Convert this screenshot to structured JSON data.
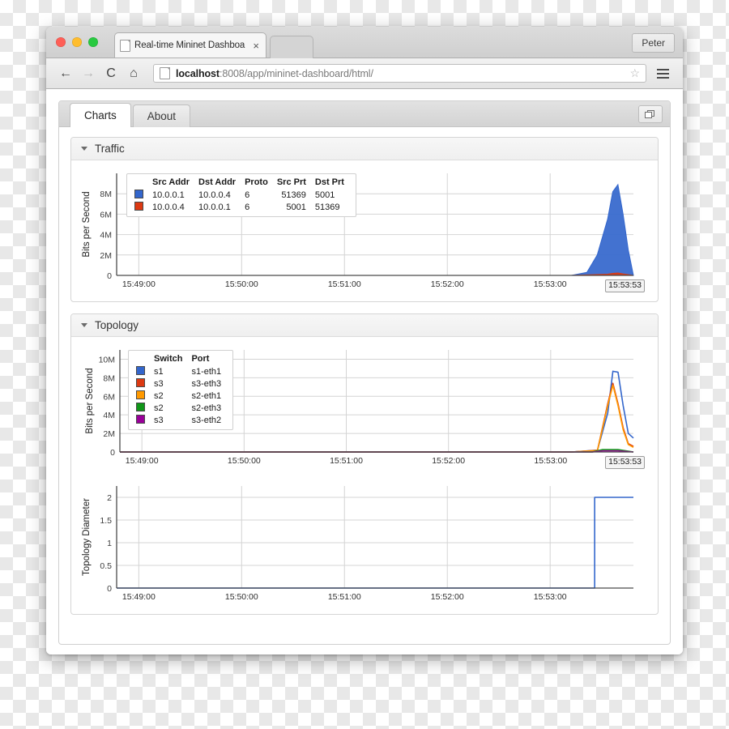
{
  "browser": {
    "tab_title": "Real-time Mininet Dashboa",
    "tab_close_glyph": "×",
    "user_label": "Peter",
    "back_glyph": "←",
    "forward_glyph": "→",
    "reload_glyph": "C",
    "home_glyph": "⌂",
    "star_glyph": "☆",
    "url_prefix": "localhost",
    "url_suffix": ":8008/app/mininet-dashboard/html/"
  },
  "app": {
    "tabs": [
      {
        "label": "Charts",
        "active": true
      },
      {
        "label": "About",
        "active": false
      }
    ],
    "windows_button_name": "open-in-new-window"
  },
  "panels": [
    {
      "title": "Traffic"
    },
    {
      "title": "Topology"
    }
  ],
  "colors": {
    "series_blue": "#3366cc",
    "series_red": "#dc3912",
    "series_orange": "#ff9900",
    "series_green": "#109618",
    "series_purple": "#990099",
    "axis": "#4a4a4a",
    "grid": "#d4d4d4"
  },
  "chart_data": [
    {
      "id": "traffic-chart",
      "type": "area",
      "title": "Traffic",
      "xlabel": "",
      "ylabel": "Bits per Second",
      "ylim": [
        0,
        10000000
      ],
      "yticks": [
        "0",
        "2M",
        "4M",
        "6M",
        "8M"
      ],
      "ytick_values": [
        0,
        2000000,
        4000000,
        6000000,
        8000000
      ],
      "xticks": [
        "15:49:00",
        "15:50:00",
        "15:51:00",
        "15:52:00",
        "15:53:00"
      ],
      "xlim": [
        "15:48:53",
        "15:53:53"
      ],
      "current_time_badge": "15:53:53",
      "grid": true,
      "legend_position": "inside-top-left",
      "legend_columns": [
        "Src Addr",
        "Dst Addr",
        "Proto",
        "Src Prt",
        "Dst Prt"
      ],
      "series": [
        {
          "name": "10.0.0.1 → 10.0.0.4",
          "color": "#3366cc",
          "legend": {
            "src_addr": "10.0.0.1",
            "dst_addr": "10.0.0.4",
            "proto": "6",
            "src_prt": "51369",
            "dst_prt": "5001"
          },
          "x": [
            0,
            88,
            91,
            93,
            95,
            96,
            97,
            98,
            99,
            100
          ],
          "values": [
            0,
            0,
            300000,
            2000000,
            5500000,
            8200000,
            8900000,
            6000000,
            2500000,
            0
          ]
        },
        {
          "name": "10.0.0.4 → 10.0.0.1",
          "color": "#dc3912",
          "legend": {
            "src_addr": "10.0.0.4",
            "dst_addr": "10.0.0.1",
            "proto": "6",
            "src_prt": "5001",
            "dst_prt": "51369"
          },
          "x": [
            0,
            88,
            95,
            96,
            97,
            98,
            100
          ],
          "values": [
            0,
            0,
            120000,
            200000,
            240000,
            150000,
            0
          ]
        }
      ]
    },
    {
      "id": "topology-traffic-chart",
      "type": "line",
      "title": "Topology",
      "xlabel": "",
      "ylabel": "Bits per Second",
      "ylim": [
        0,
        11000000
      ],
      "yticks": [
        "0",
        "2M",
        "4M",
        "6M",
        "8M",
        "10M"
      ],
      "ytick_values": [
        0,
        2000000,
        4000000,
        6000000,
        8000000,
        10000000
      ],
      "xticks": [
        "15:49:00",
        "15:50:00",
        "15:51:00",
        "15:52:00",
        "15:53:00"
      ],
      "xlim": [
        "15:48:53",
        "15:53:53"
      ],
      "current_time_badge": "15:53:53",
      "grid": true,
      "legend_position": "inside-top-left",
      "legend_columns": [
        "Switch",
        "Port"
      ],
      "series": [
        {
          "name": "s1 s1-eth1",
          "color": "#3366cc",
          "legend": {
            "switch": "s1",
            "port": "s1-eth1"
          },
          "x": [
            0,
            88,
            93,
            95,
            96,
            97,
            98,
            99,
            100
          ],
          "values": [
            0,
            0,
            200000,
            4200000,
            8700000,
            8600000,
            5000000,
            2000000,
            1500000
          ]
        },
        {
          "name": "s3 s3-eth3",
          "color": "#dc3912",
          "legend": {
            "switch": "s3",
            "port": "s3-eth3"
          },
          "x": [
            0,
            88,
            93,
            95,
            96,
            97,
            98,
            99,
            100
          ],
          "values": [
            0,
            0,
            180000,
            5200000,
            7400000,
            5200000,
            2600000,
            900000,
            600000
          ]
        },
        {
          "name": "s2 s2-eth1",
          "color": "#ff9900",
          "legend": {
            "switch": "s2",
            "port": "s2-eth1"
          },
          "x": [
            0,
            88,
            93,
            95,
            96,
            97,
            98,
            99,
            100
          ],
          "values": [
            0,
            0,
            160000,
            5000000,
            7200000,
            5000000,
            2400000,
            800000,
            500000
          ]
        },
        {
          "name": "s2 s2-eth3",
          "color": "#109618",
          "legend": {
            "switch": "s2",
            "port": "s2-eth3"
          },
          "x": [
            0,
            92,
            94,
            97,
            100
          ],
          "values": [
            0,
            0,
            260000,
            260000,
            0
          ]
        },
        {
          "name": "s3 s3-eth2",
          "color": "#990099",
          "legend": {
            "switch": "s3",
            "port": "s3-eth2"
          },
          "x": [
            0,
            92,
            94,
            97,
            100
          ],
          "values": [
            0,
            0,
            120000,
            120000,
            0
          ]
        }
      ]
    },
    {
      "id": "topology-diameter-chart",
      "type": "line",
      "title": "Topology Diameter",
      "xlabel": "",
      "ylabel": "Topology Diameter",
      "ylim": [
        0,
        2.25
      ],
      "yticks": [
        "0",
        "0.5",
        "1",
        "1.5",
        "2"
      ],
      "ytick_values": [
        0,
        0.5,
        1,
        1.5,
        2
      ],
      "xticks": [
        "15:49:00",
        "15:50:00",
        "15:51:00",
        "15:52:00",
        "15:53:00"
      ],
      "xlim": [
        "15:48:53",
        "15:53:53"
      ],
      "grid": true,
      "series": [
        {
          "name": "Topology Diameter",
          "color": "#3366cc",
          "x": [
            0,
            92.5,
            92.5,
            100
          ],
          "values": [
            0,
            0,
            2,
            2
          ]
        }
      ]
    }
  ]
}
